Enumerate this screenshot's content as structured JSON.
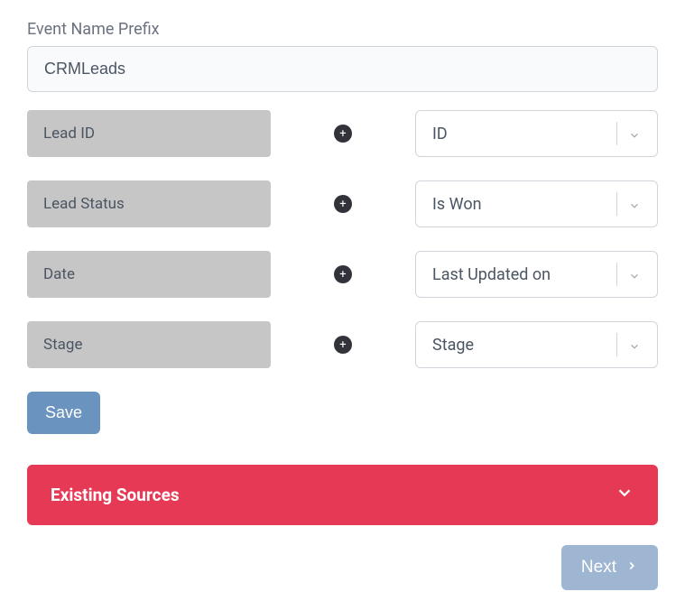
{
  "prefix": {
    "label": "Event Name Prefix",
    "value": "CRMLeads"
  },
  "mappings": [
    {
      "field": "Lead ID",
      "value": "ID"
    },
    {
      "field": "Lead Status",
      "value": "Is Won"
    },
    {
      "field": "Date",
      "value": "Last Updated on"
    },
    {
      "field": "Stage",
      "value": "Stage"
    }
  ],
  "buttons": {
    "save": "Save",
    "next": "Next"
  },
  "accordion": {
    "existing_sources": "Existing Sources"
  }
}
